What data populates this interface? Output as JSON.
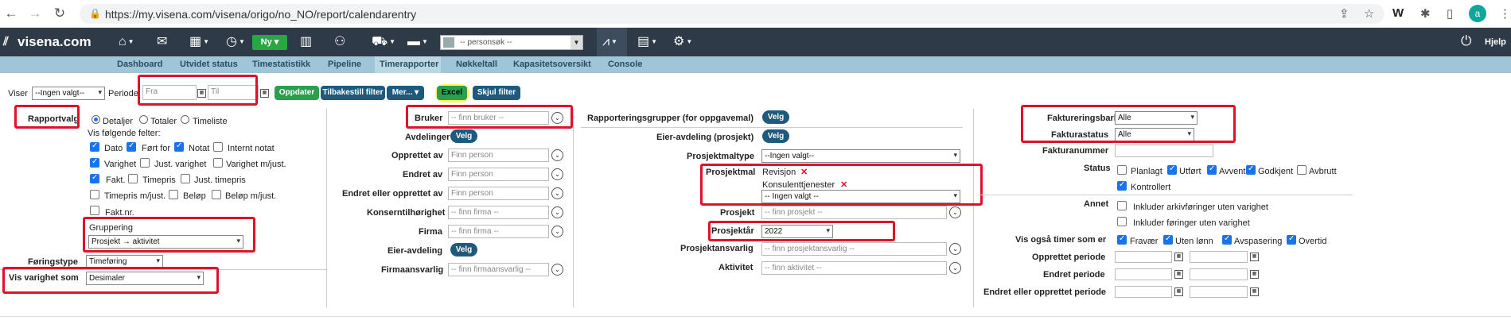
{
  "browser": {
    "url": "https://my.visena.com/visena/origo/no_NO/report/calendarentry",
    "avatar_letter": "a"
  },
  "header": {
    "logo": "visena.com",
    "ny_label": "Ny",
    "person_search": "-- personsøk --",
    "help": "Hjelp"
  },
  "tabs": [
    "Dashboard",
    "Utvidet status",
    "Timestatistikk",
    "Pipeline",
    "Timerapporter",
    "Nøkkeltall",
    "Kapasitetsoversikt",
    "Console"
  ],
  "toolbar": {
    "viser_label": "Viser",
    "viser_value": "--Ingen valgt--",
    "periode_label": "Periode",
    "fra_placeholder": "Fra",
    "til_placeholder": "Til",
    "oppdater": "Oppdater",
    "tilbakestill": "Tilbakestill filter",
    "mer": "Mer...",
    "excel": "Excel",
    "skjul": "Skjul filter"
  },
  "col1": {
    "rapportvalg": "Rapportvalg",
    "radio_detaljer": "Detaljer",
    "radio_totaler": "Totaler",
    "radio_timeliste": "Timeliste",
    "vis_folgende": "Vis følgende felter:",
    "fields": {
      "dato": "Dato",
      "fort_for": "Ført for",
      "notat": "Notat",
      "internt_notat": "Internt notat",
      "varighet": "Varighet",
      "just_varighet": "Just. varighet",
      "varighet_mjust": "Varighet m/just.",
      "fakt": "Fakt.",
      "timepris": "Timepris",
      "just_timepris": "Just. timepris",
      "timepris_mjust": "Timepris m/just.",
      "belop": "Beløp",
      "belop_mjust": "Beløp m/just.",
      "fakt_nr": "Fakt.nr."
    },
    "gruppering_label": "Gruppering",
    "gruppering_value": "Prosjekt → aktivitet",
    "foringstype_label": "Føringstype",
    "foringstype_value": "Timeføring",
    "vis_varighet_label": "Vis varighet som",
    "vis_varighet_value": "Desimaler"
  },
  "col2": {
    "bruker": "Bruker",
    "bruker_placeholder": "-- finn bruker --",
    "avdelinger": "Avdelinger",
    "velg": "Velg",
    "opprettet_av": "Opprettet av",
    "endret_av": "Endret av",
    "endret_eller_opprettet_av": "Endret eller opprettet av",
    "finn_person": "Finn person",
    "konsernt": "Konserntilhørighet",
    "finn_firma": "-- finn firma --",
    "firma": "Firma",
    "eier_avdeling": "Eier-avdeling",
    "firmaansvarlig": "Firmaansvarlig",
    "finn_firmaansvarlig": "-- finn firmaansvarlig --"
  },
  "col3": {
    "rapporteringsgrupper": "Rapporteringsgrupper (for oppgavemal)",
    "eier_avd_prosjekt": "Eier-avdeling (prosjekt)",
    "prosjektmaltype": "Prosjektmaltype",
    "ingen_valgt": "--Ingen valgt--",
    "prosjektmal": "Prosjektmal",
    "mal_items": [
      "Revisjon",
      "Konsulenttjenester"
    ],
    "mal_select": "-- Ingen valgt --",
    "prosjekt": "Prosjekt",
    "finn_prosjekt": "-- finn prosjekt --",
    "prosjektar": "Prosjektår",
    "prosjektar_value": "2022",
    "prosjektansvarlig": "Prosjektansvarlig",
    "finn_prosjektansvarlig": "-- finn prosjektansvarlig --",
    "aktivitet": "Aktivitet",
    "finn_aktivitet": "-- finn aktivitet --"
  },
  "col4": {
    "faktureringsbarhet": "Faktureringsbarhet",
    "faktureringsbarhet_value": "Alle",
    "fakturastatus": "Fakturastatus",
    "fakturastatus_value": "Alle",
    "fakturanummer": "Fakturanummer",
    "status": "Status",
    "status_items": {
      "planlagt": "Planlagt",
      "utfort": "Utført",
      "avvent": "Avvent",
      "godkjent": "Godkjent",
      "avbrutt": "Avbrutt",
      "kontrollert": "Kontrollert"
    },
    "annet": "Annet",
    "annet_1": "Inkluder arkivføringer uten varighet",
    "annet_2": "Inkluder føringer uten varighet",
    "vis_ogsa": "Vis også timer som er",
    "vis_items": {
      "fravar": "Fravær",
      "uten_lonn": "Uten lønn",
      "avspasering": "Avspasering",
      "overtid": "Overtid"
    },
    "opprettet_periode": "Opprettet periode",
    "endret_periode": "Endret periode",
    "endret_eller_opprettet_periode": "Endret eller opprettet periode"
  }
}
